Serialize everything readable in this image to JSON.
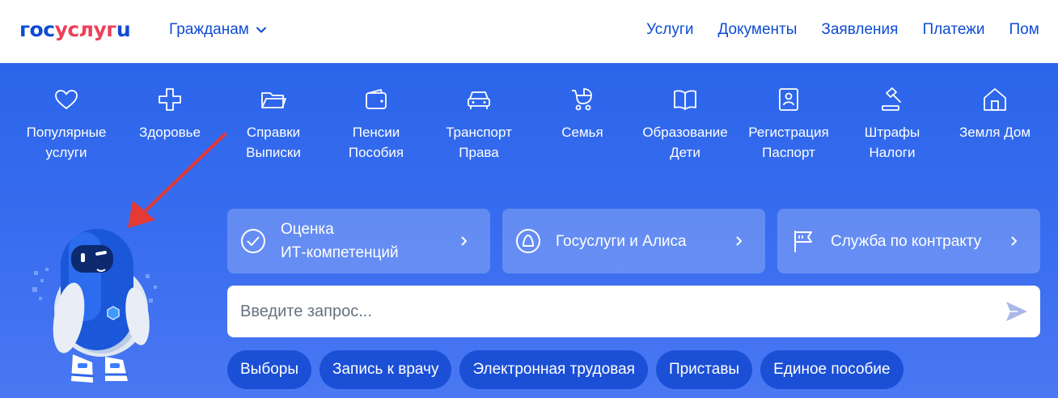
{
  "header": {
    "logo": {
      "part1": "гос",
      "part2": "услуг",
      "part3": "u"
    },
    "audience": "Гражданам",
    "nav": [
      "Услуги",
      "Документы",
      "Заявления",
      "Платежи",
      "Пом"
    ]
  },
  "categories": [
    {
      "line1": "Популярные",
      "line2": "услуги",
      "icon": "heart-icon"
    },
    {
      "line1": "Здоровье",
      "line2": "",
      "icon": "medical-cross-icon"
    },
    {
      "line1": "Справки",
      "line2": "Выписки",
      "icon": "folder-icon"
    },
    {
      "line1": "Пенсии",
      "line2": "Пособия",
      "icon": "wallet-icon"
    },
    {
      "line1": "Транспорт",
      "line2": "Права",
      "icon": "car-icon"
    },
    {
      "line1": "Семья",
      "line2": "",
      "icon": "stroller-icon"
    },
    {
      "line1": "Образование",
      "line2": "Дети",
      "icon": "book-icon"
    },
    {
      "line1": "Регистрация",
      "line2": "Паспорт",
      "icon": "passport-icon"
    },
    {
      "line1": "Штрафы",
      "line2": "Налоги",
      "icon": "gavel-icon"
    },
    {
      "line1": "Земля Дом",
      "line2": "",
      "icon": "house-icon"
    }
  ],
  "promos": [
    {
      "text": "Оценка\nИТ-компетенций",
      "icon": "check-circle-icon"
    },
    {
      "text": "Госуслуги и Алиса",
      "icon": "alice-icon"
    },
    {
      "text": "Служба по контракту",
      "icon": "flag-icon"
    }
  ],
  "search": {
    "placeholder": "Введите запрос..."
  },
  "chips": [
    "Выборы",
    "Запись к врачу",
    "Электронная трудовая",
    "Приставы",
    "Единое пособие"
  ],
  "colors": {
    "brand_blue": "#0d4cd3",
    "brand_red": "#ee3f58",
    "hero_bg": "#3a6df0",
    "chip_bg": "#1b4fd6",
    "arrow": "#e53935"
  }
}
